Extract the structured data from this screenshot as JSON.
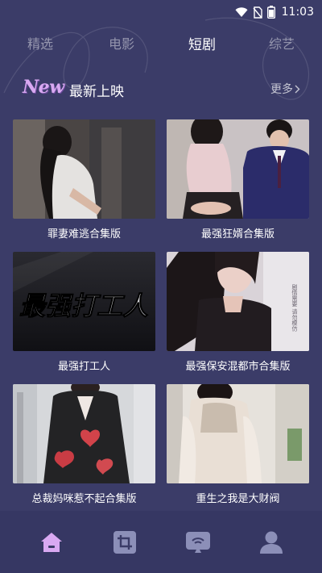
{
  "status_bar": {
    "time": "11:03"
  },
  "tabs": [
    {
      "label": "精选",
      "active": false
    },
    {
      "label": "电影",
      "active": false
    },
    {
      "label": "短剧",
      "active": true
    },
    {
      "label": "综艺",
      "active": false
    }
  ],
  "section": {
    "badge": "New",
    "title": "最新上映",
    "more": "更多"
  },
  "cards": [
    {
      "title": "罪妻难逃合集版"
    },
    {
      "title": "最强狂婿合集版"
    },
    {
      "title": "最强打工人",
      "poster_text": "最强打工人"
    },
    {
      "title": "最强保安混都市合集版",
      "side_text": "剧情需要 请勿模仿"
    },
    {
      "title": "总裁妈咪惹不起合集版"
    },
    {
      "title": "重生之我是大财阀"
    }
  ],
  "bottom_nav": [
    {
      "icon": "home-icon",
      "active": true
    },
    {
      "icon": "crop-icon",
      "active": false
    },
    {
      "icon": "cast-icon",
      "active": false
    },
    {
      "icon": "profile-icon",
      "active": false
    }
  ],
  "colors": {
    "background": "#3b3c68",
    "nav_background": "#363763",
    "accent": "#d9a9f2",
    "inactive_icon": "#8c8fb8"
  }
}
